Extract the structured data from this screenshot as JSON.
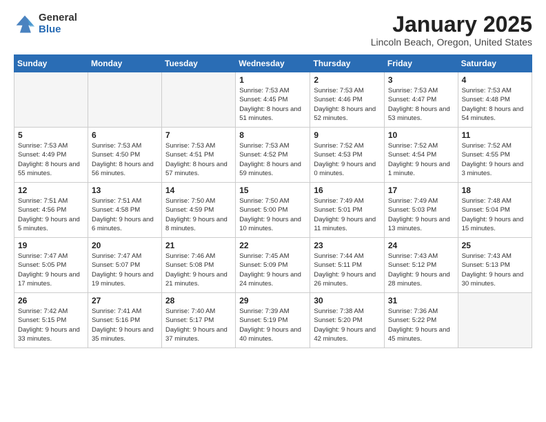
{
  "logo": {
    "general": "General",
    "blue": "Blue"
  },
  "title": "January 2025",
  "subtitle": "Lincoln Beach, Oregon, United States",
  "weekdays": [
    "Sunday",
    "Monday",
    "Tuesday",
    "Wednesday",
    "Thursday",
    "Friday",
    "Saturday"
  ],
  "weeks": [
    [
      {
        "day": "",
        "info": ""
      },
      {
        "day": "",
        "info": ""
      },
      {
        "day": "",
        "info": ""
      },
      {
        "day": "1",
        "info": "Sunrise: 7:53 AM\nSunset: 4:45 PM\nDaylight: 8 hours\nand 51 minutes."
      },
      {
        "day": "2",
        "info": "Sunrise: 7:53 AM\nSunset: 4:46 PM\nDaylight: 8 hours\nand 52 minutes."
      },
      {
        "day": "3",
        "info": "Sunrise: 7:53 AM\nSunset: 4:47 PM\nDaylight: 8 hours\nand 53 minutes."
      },
      {
        "day": "4",
        "info": "Sunrise: 7:53 AM\nSunset: 4:48 PM\nDaylight: 8 hours\nand 54 minutes."
      }
    ],
    [
      {
        "day": "5",
        "info": "Sunrise: 7:53 AM\nSunset: 4:49 PM\nDaylight: 8 hours\nand 55 minutes."
      },
      {
        "day": "6",
        "info": "Sunrise: 7:53 AM\nSunset: 4:50 PM\nDaylight: 8 hours\nand 56 minutes."
      },
      {
        "day": "7",
        "info": "Sunrise: 7:53 AM\nSunset: 4:51 PM\nDaylight: 8 hours\nand 57 minutes."
      },
      {
        "day": "8",
        "info": "Sunrise: 7:53 AM\nSunset: 4:52 PM\nDaylight: 8 hours\nand 59 minutes."
      },
      {
        "day": "9",
        "info": "Sunrise: 7:52 AM\nSunset: 4:53 PM\nDaylight: 9 hours\nand 0 minutes."
      },
      {
        "day": "10",
        "info": "Sunrise: 7:52 AM\nSunset: 4:54 PM\nDaylight: 9 hours\nand 1 minute."
      },
      {
        "day": "11",
        "info": "Sunrise: 7:52 AM\nSunset: 4:55 PM\nDaylight: 9 hours\nand 3 minutes."
      }
    ],
    [
      {
        "day": "12",
        "info": "Sunrise: 7:51 AM\nSunset: 4:56 PM\nDaylight: 9 hours\nand 5 minutes."
      },
      {
        "day": "13",
        "info": "Sunrise: 7:51 AM\nSunset: 4:58 PM\nDaylight: 9 hours\nand 6 minutes."
      },
      {
        "day": "14",
        "info": "Sunrise: 7:50 AM\nSunset: 4:59 PM\nDaylight: 9 hours\nand 8 minutes."
      },
      {
        "day": "15",
        "info": "Sunrise: 7:50 AM\nSunset: 5:00 PM\nDaylight: 9 hours\nand 10 minutes."
      },
      {
        "day": "16",
        "info": "Sunrise: 7:49 AM\nSunset: 5:01 PM\nDaylight: 9 hours\nand 11 minutes."
      },
      {
        "day": "17",
        "info": "Sunrise: 7:49 AM\nSunset: 5:03 PM\nDaylight: 9 hours\nand 13 minutes."
      },
      {
        "day": "18",
        "info": "Sunrise: 7:48 AM\nSunset: 5:04 PM\nDaylight: 9 hours\nand 15 minutes."
      }
    ],
    [
      {
        "day": "19",
        "info": "Sunrise: 7:47 AM\nSunset: 5:05 PM\nDaylight: 9 hours\nand 17 minutes."
      },
      {
        "day": "20",
        "info": "Sunrise: 7:47 AM\nSunset: 5:07 PM\nDaylight: 9 hours\nand 19 minutes."
      },
      {
        "day": "21",
        "info": "Sunrise: 7:46 AM\nSunset: 5:08 PM\nDaylight: 9 hours\nand 21 minutes."
      },
      {
        "day": "22",
        "info": "Sunrise: 7:45 AM\nSunset: 5:09 PM\nDaylight: 9 hours\nand 24 minutes."
      },
      {
        "day": "23",
        "info": "Sunrise: 7:44 AM\nSunset: 5:11 PM\nDaylight: 9 hours\nand 26 minutes."
      },
      {
        "day": "24",
        "info": "Sunrise: 7:43 AM\nSunset: 5:12 PM\nDaylight: 9 hours\nand 28 minutes."
      },
      {
        "day": "25",
        "info": "Sunrise: 7:43 AM\nSunset: 5:13 PM\nDaylight: 9 hours\nand 30 minutes."
      }
    ],
    [
      {
        "day": "26",
        "info": "Sunrise: 7:42 AM\nSunset: 5:15 PM\nDaylight: 9 hours\nand 33 minutes."
      },
      {
        "day": "27",
        "info": "Sunrise: 7:41 AM\nSunset: 5:16 PM\nDaylight: 9 hours\nand 35 minutes."
      },
      {
        "day": "28",
        "info": "Sunrise: 7:40 AM\nSunset: 5:17 PM\nDaylight: 9 hours\nand 37 minutes."
      },
      {
        "day": "29",
        "info": "Sunrise: 7:39 AM\nSunset: 5:19 PM\nDaylight: 9 hours\nand 40 minutes."
      },
      {
        "day": "30",
        "info": "Sunrise: 7:38 AM\nSunset: 5:20 PM\nDaylight: 9 hours\nand 42 minutes."
      },
      {
        "day": "31",
        "info": "Sunrise: 7:36 AM\nSunset: 5:22 PM\nDaylight: 9 hours\nand 45 minutes."
      },
      {
        "day": "",
        "info": ""
      }
    ]
  ]
}
